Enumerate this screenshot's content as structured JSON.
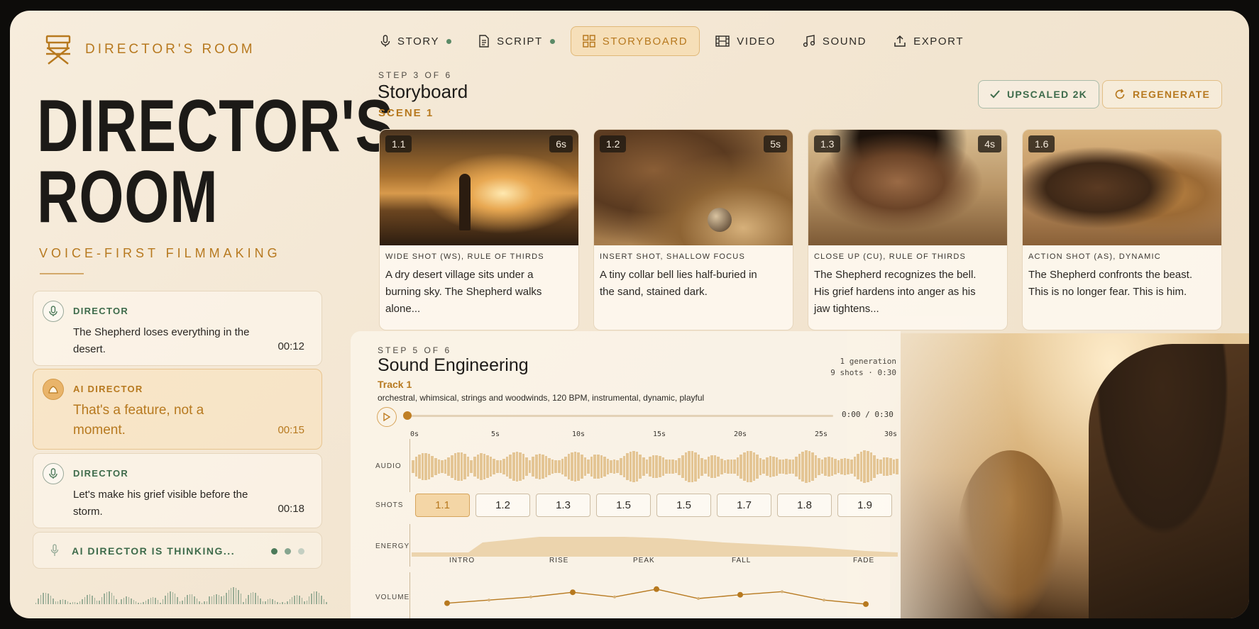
{
  "brand": {
    "name": "DIRECTOR'S ROOM",
    "hero_line1": "DIRECTOR'S",
    "hero_line2": "ROOM",
    "tagline": "VOICE-FIRST FILMMAKING"
  },
  "chat": [
    {
      "role": "DIRECTOR",
      "text": "The Shepherd loses everything in the desert.",
      "time": "00:12",
      "icon": "microphone-icon"
    },
    {
      "role": "AI DIRECTOR",
      "text": "That's a feature, not a moment.",
      "time": "00:15",
      "icon": "ai-director-icon"
    },
    {
      "role": "DIRECTOR",
      "text": "Let's make his grief visible before the storm.",
      "time": "00:18",
      "icon": "microphone-icon"
    }
  ],
  "thinking": {
    "label": "AI DIRECTOR IS THINKING..."
  },
  "nav": [
    {
      "label": "STORY",
      "icon": "microphone-icon",
      "done": true
    },
    {
      "label": "SCRIPT",
      "icon": "document-icon",
      "done": true
    },
    {
      "label": "STORYBOARD",
      "icon": "grid-icon",
      "active": true
    },
    {
      "label": "VIDEO",
      "icon": "film-icon"
    },
    {
      "label": "SOUND",
      "icon": "music-note-icon"
    },
    {
      "label": "EXPORT",
      "icon": "upload-icon"
    }
  ],
  "storyboard": {
    "step": "STEP 3 OF 6",
    "title": "Storyboard",
    "scene": "SCENE 1",
    "upscaled_label": "UPSCALED 2K",
    "regenerate_label": "REGENERATE",
    "cards": [
      {
        "id": "1.1",
        "duration": "6s",
        "shot": "WIDE SHOT (WS), RULE OF THIRDS",
        "desc": "A dry desert village sits under a burning sky. The Shepherd walks alone..."
      },
      {
        "id": "1.2",
        "duration": "5s",
        "shot": "INSERT SHOT, SHALLOW FOCUS",
        "desc": "A tiny collar bell lies half-buried in the sand, stained dark."
      },
      {
        "id": "1.3",
        "duration": "4s",
        "shot": "CLOSE UP (CU), RULE OF THIRDS",
        "desc": "The Shepherd recognizes the bell. His grief hardens into anger as his jaw tightens..."
      },
      {
        "id": "1.6",
        "duration": "",
        "shot": "ACTION SHOT (AS), DYNAMIC",
        "desc": "The Shepherd confronts the beast. This is no longer fear. This is him."
      }
    ]
  },
  "sound": {
    "step": "STEP 5 OF 6",
    "title": "Sound Engineering",
    "track": "Track 1",
    "generations": "1 generation",
    "summary": "9 shots · 0:30",
    "params": "orchestral, whimsical, strings and woodwinds, 120 BPM, instrumental, dynamic, playful",
    "timecode": "0:00 / 0:30",
    "progress": 0,
    "ruler": [
      "0s",
      "5s",
      "10s",
      "15s",
      "20s",
      "25s",
      "30s"
    ],
    "row_labels": {
      "audio": "AUDIO",
      "shots": "SHOTS",
      "energy": "ENERGY",
      "volume": "VOLUME"
    },
    "shots": [
      "1.1",
      "1.2",
      "1.3",
      "1.5",
      "1.5",
      "1.7",
      "1.8",
      "1.9"
    ],
    "selected_shot": 0,
    "energy_labels": [
      "INTRO",
      "RISE",
      "PEAK",
      "FALL",
      "FADE"
    ],
    "volume_points": [
      0.35,
      0.45,
      0.55,
      0.7,
      0.55,
      0.8,
      0.5,
      0.62,
      0.72,
      0.45,
      0.32
    ],
    "accent": "#b7791f"
  }
}
